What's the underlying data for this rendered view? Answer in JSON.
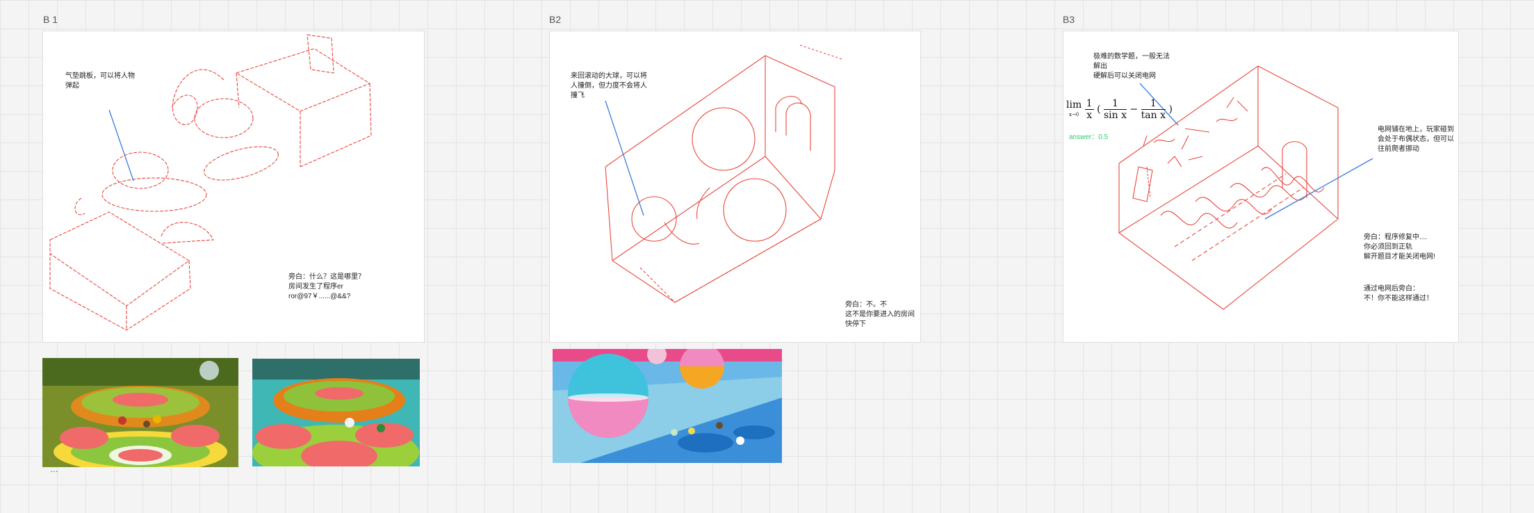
{
  "frames": {
    "b1": {
      "label": "B 1",
      "note_bounce": "气垫跳板，可以将人物\n弹起",
      "note_narration": "旁白：什么？这是哪里？\n房间发生了程序er\nror@97￥......@&&?"
    },
    "b2": {
      "label": "B2",
      "note_ball": "来回滚动的大球，可以将\n人撞倒，但力度不会将人\n撞飞",
      "note_narration": "旁白：不。不\n这不是你要进入的房间\n快停下"
    },
    "b3": {
      "label": "B3",
      "note_math": "极难的数学题，一般无法\n解出\n硬解后可以关闭电网",
      "formula": {
        "lim": "lim",
        "sub": "x→0",
        "f1_num": "1",
        "f1_den": "x",
        "f2_num": "1",
        "f2_den": "sin x",
        "f3_num": "1",
        "f3_den": "tan x",
        "minus": "−",
        "lp": "(",
        "rp": ")"
      },
      "answer": "answer：0.5",
      "note_grid": "电网铺在地上，玩家碰到\n会处于布偶状态，但可以\n往前爬者挪动",
      "note_narration1": "旁白：程序修复中....\n你必须回到正轨\n解开题目才能关闭电网!",
      "note_narration2": "通过电网后旁白：\n不！你不能这样通过！"
    }
  },
  "caption": "…"
}
